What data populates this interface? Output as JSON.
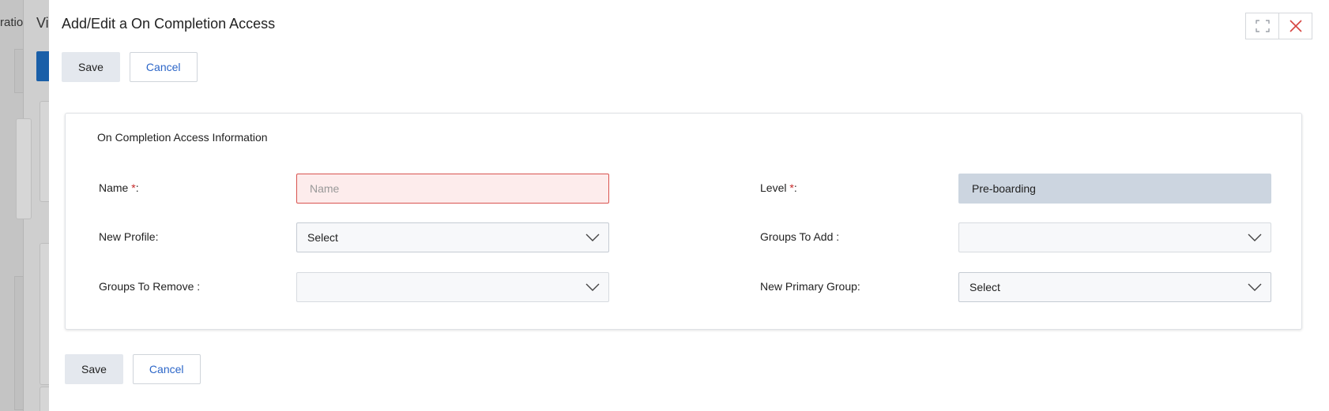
{
  "background": {
    "crumb_text": "ratio",
    "title_fragment": "Vi"
  },
  "modal": {
    "title": "Add/Edit a On Completion Access",
    "controls": {
      "maximize_icon": "maximize-icon",
      "close_icon": "close-icon"
    },
    "top_actions": {
      "save_label": "Save",
      "cancel_label": "Cancel"
    },
    "bottom_actions": {
      "save_label": "Save",
      "cancel_label": "Cancel"
    },
    "panel": {
      "title": "On Completion Access Information",
      "fields": {
        "name": {
          "label": "Name",
          "required_mark": "*",
          "suffix": ":",
          "placeholder": "Name",
          "value": ""
        },
        "level": {
          "label": "Level ",
          "required_mark": "*",
          "suffix": ":",
          "value": "Pre-boarding"
        },
        "new_profile": {
          "label": "New Profile:",
          "value": "Select"
        },
        "groups_to_add": {
          "label": "Groups To Add :",
          "value": ""
        },
        "groups_to_remove": {
          "label": "Groups To Remove :",
          "value": ""
        },
        "new_primary_group": {
          "label": "New Primary Group:",
          "value": "Select"
        }
      }
    }
  },
  "colors": {
    "accent_link": "#2c66c8",
    "required": "#c62828",
    "error_bg": "#fdecec",
    "error_border": "#d9534f",
    "readonly_bg": "#ccd5e0",
    "close_icon": "#d64541"
  }
}
